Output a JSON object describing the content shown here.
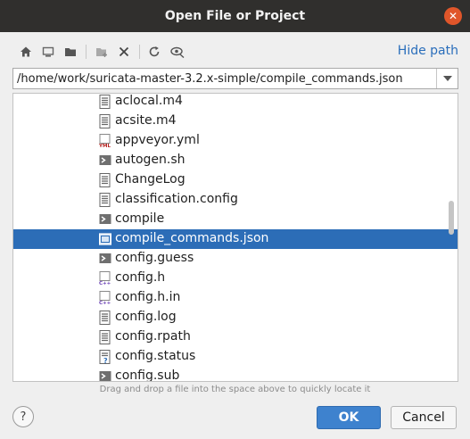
{
  "window": {
    "title": "Open File or Project"
  },
  "toolbar": {
    "icons": [
      "home-icon",
      "desktop-icon",
      "project-folder-icon",
      "new-folder-icon",
      "delete-icon",
      "refresh-icon",
      "hidden-files-icon"
    ],
    "hide_path_label": "Hide path"
  },
  "path": {
    "value": "/home/work/suricata-master-3.2.x-simple/compile_commands.json"
  },
  "files": [
    {
      "name": "aclocal.m4",
      "icon": "text-file-icon",
      "selected": false
    },
    {
      "name": "acsite.m4",
      "icon": "text-file-icon",
      "selected": false
    },
    {
      "name": "appveyor.yml",
      "icon": "yml-file-icon",
      "selected": false
    },
    {
      "name": "autogen.sh",
      "icon": "shell-script-icon",
      "selected": false
    },
    {
      "name": "ChangeLog",
      "icon": "text-file-icon",
      "selected": false
    },
    {
      "name": "classification.config",
      "icon": "text-file-icon",
      "selected": false
    },
    {
      "name": "compile",
      "icon": "shell-script-icon",
      "selected": false
    },
    {
      "name": "compile_commands.json",
      "icon": "json-file-icon",
      "selected": true
    },
    {
      "name": "config.guess",
      "icon": "shell-script-icon",
      "selected": false
    },
    {
      "name": "config.h",
      "icon": "cpp-header-icon",
      "selected": false
    },
    {
      "name": "config.h.in",
      "icon": "cpp-header-icon",
      "selected": false
    },
    {
      "name": "config.log",
      "icon": "text-file-icon",
      "selected": false
    },
    {
      "name": "config.rpath",
      "icon": "text-file-icon",
      "selected": false
    },
    {
      "name": "config.status",
      "icon": "unknown-file-icon",
      "selected": false
    },
    {
      "name": "config.sub",
      "icon": "shell-script-icon",
      "selected": false
    }
  ],
  "hint": "Drag and drop a file into the space above to quickly locate it",
  "buttons": {
    "help": "?",
    "ok": "OK",
    "cancel": "Cancel"
  },
  "colors": {
    "accent": "#2c6db7",
    "ok_button": "#3e82ce",
    "close_button": "#e0562a",
    "titlebar": "#302f2d"
  }
}
